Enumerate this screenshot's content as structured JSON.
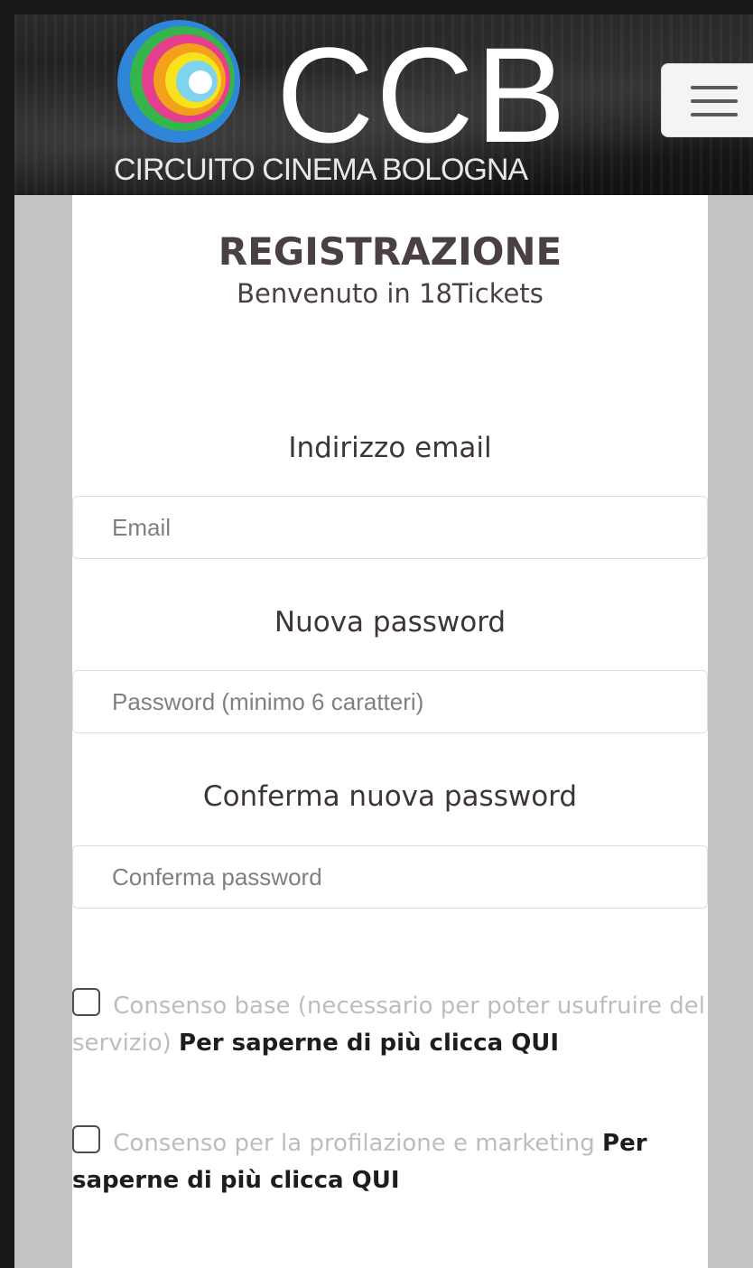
{
  "header": {
    "logo_text": "CCB",
    "logo_subtitle": "CIRCUITO CINEMA BOLOGNA",
    "menu_icon": "hamburger-menu-icon"
  },
  "page": {
    "title": "REGISTRAZIONE",
    "subtitle": "Benvenuto in 18Tickets"
  },
  "form": {
    "email_label": "Indirizzo email",
    "email_placeholder": "Email",
    "password_label": "Nuova password",
    "password_placeholder": "Password (minimo 6 caratteri)",
    "confirm_label": "Conferma nuova password",
    "confirm_placeholder": "Conferma password"
  },
  "consents": [
    {
      "text": "Consenso base (necessario per poter usufruire del servizio)",
      "link": "Per saperne di più clicca QUI",
      "checked": false
    },
    {
      "text": "Consenso per la profilazione e marketing",
      "link": "Per saperne di più clicca QUI",
      "checked": false
    }
  ],
  "colors": {
    "page_bg": "#c3c4c3",
    "card_bg": "#ffffff",
    "title": "#4a3f42",
    "consent_text": "#bdbdbd",
    "link_text": "#1d1d1d"
  }
}
